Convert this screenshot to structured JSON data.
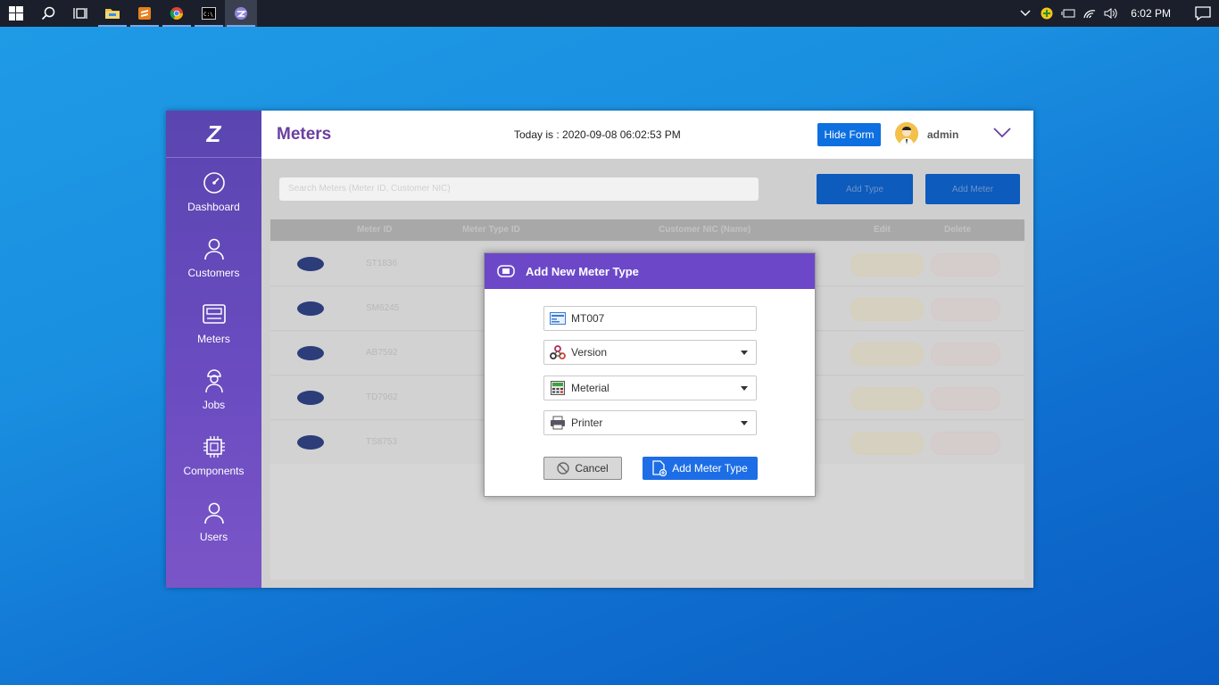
{
  "taskbar": {
    "apps": [
      "start",
      "search",
      "task-view",
      "file-explorer",
      "sublime-text",
      "chrome",
      "command-prompt",
      "meter-app"
    ],
    "clock": "6:02 PM"
  },
  "app": {
    "sidebar": {
      "logo": "Z",
      "items": [
        {
          "label": "Dashboard",
          "icon": "speedometer-icon"
        },
        {
          "label": "Customers",
          "icon": "person-icon"
        },
        {
          "label": "Meters",
          "icon": "meter-icon"
        },
        {
          "label": "Jobs",
          "icon": "worker-icon"
        },
        {
          "label": "Components",
          "icon": "chip-icon"
        },
        {
          "label": "Users",
          "icon": "user-icon"
        }
      ]
    },
    "header": {
      "title": "Meters",
      "today": "Today is : 2020-09-08 06:02:53 PM",
      "hide_form": "Hide Form",
      "user": "admin"
    },
    "background": {
      "search_placeholder": "Search Meters (Meter ID, Customer NIC)",
      "add_type": "Add Type",
      "add_meter": "Add Meter",
      "columns": [
        "Meter ID",
        "Meter Type ID",
        "Customer NIC (Name)",
        "Edit",
        "Delete"
      ],
      "rows": [
        "ST1836",
        "SM6245",
        "AB7592",
        "TD7962",
        "TS8753"
      ],
      "edit_label": "Edit",
      "delete_label": "Delete"
    }
  },
  "modal": {
    "title": "Add New Meter Type",
    "id_value": "MT007",
    "version": "Version",
    "material": "Meterial",
    "printer": "Printer",
    "cancel": "Cancel",
    "add": "Add Meter Type"
  },
  "colors": {
    "sidebar": "#6a4cc0",
    "modal_header": "#6c48c9",
    "primary": "#1d6ee6",
    "title": "#6a3ea1"
  }
}
